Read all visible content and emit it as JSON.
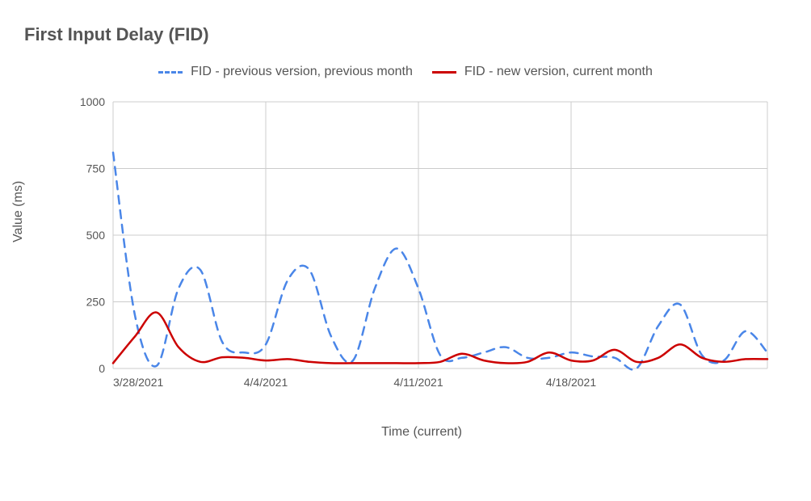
{
  "chart_data": {
    "type": "line",
    "title": "First Input Delay (FID)",
    "xlabel": "Time (current)",
    "ylabel": "Value (ms)",
    "ylim": [
      0,
      1000
    ],
    "yticks": [
      0,
      250,
      500,
      750,
      1000
    ],
    "xticks": [
      "3/28/2021",
      "4/4/2021",
      "4/11/2021",
      "4/18/2021"
    ],
    "x_tick_indices": [
      0,
      7,
      14,
      21
    ],
    "n_points": 28,
    "series": [
      {
        "name": "FID - previous version, previous month",
        "style": "dashed",
        "color": "#4a86e8",
        "values": [
          810,
          200,
          10,
          300,
          370,
          100,
          60,
          90,
          330,
          370,
          120,
          30,
          300,
          450,
          300,
          50,
          40,
          60,
          80,
          40,
          40,
          60,
          45,
          40,
          0,
          160,
          240,
          50,
          30,
          140,
          60
        ]
      },
      {
        "name": "FID - new version, current month",
        "style": "solid",
        "color": "#cc0000",
        "values": [
          20,
          120,
          210,
          80,
          25,
          42,
          40,
          30,
          35,
          25,
          20,
          20,
          20,
          20,
          20,
          25,
          55,
          30,
          20,
          25,
          60,
          30,
          30,
          70,
          25,
          40,
          90,
          40,
          25,
          35,
          35
        ]
      }
    ],
    "legend": [
      "FID - previous version, previous month",
      "FID - new version, current month"
    ]
  }
}
